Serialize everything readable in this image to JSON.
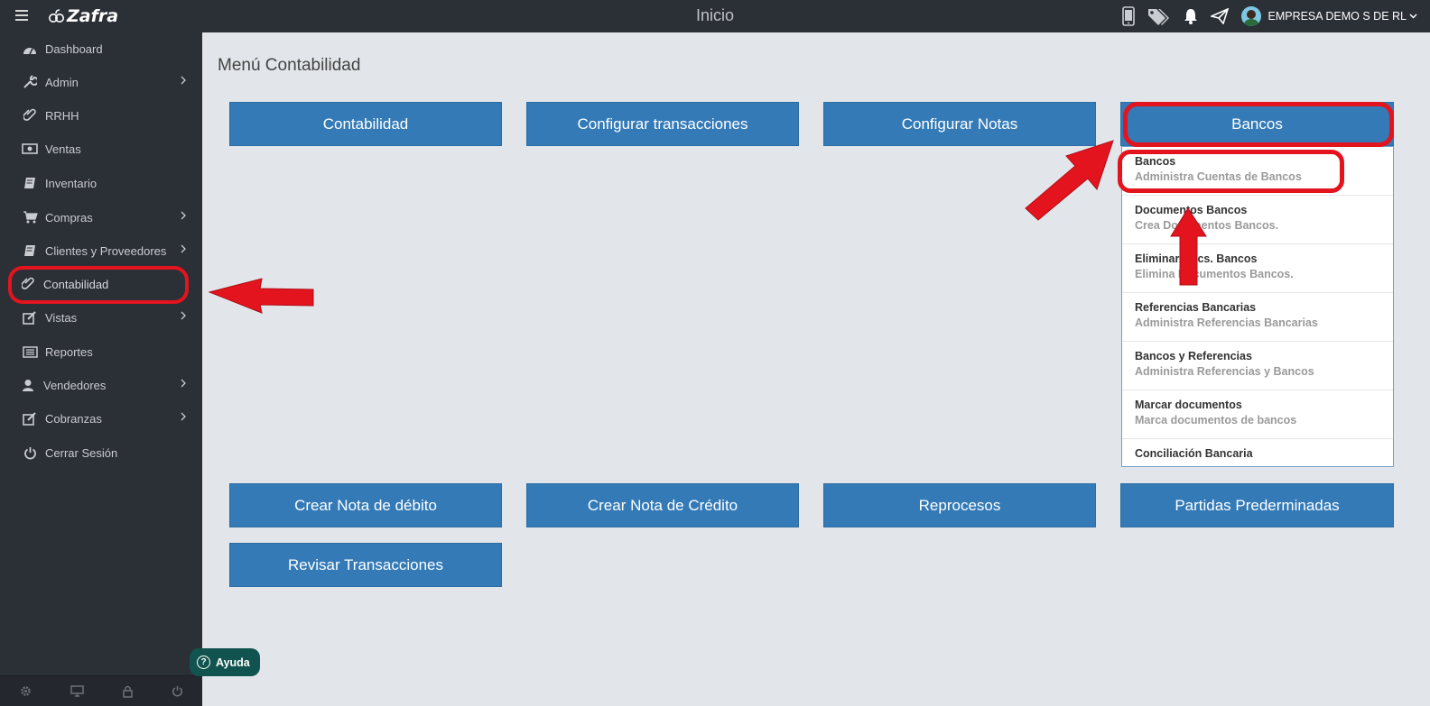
{
  "app": {
    "name": "Zafra",
    "page_title": "Inicio",
    "company": "EMPRESA DEMO S DE RL"
  },
  "topbar_icons": [
    "phone-icon",
    "tags-icon",
    "bell-icon",
    "paper-plane-icon"
  ],
  "sidebar": {
    "items": [
      {
        "label": "Dashboard",
        "icon": "dashboard-icon",
        "has_submenu": false
      },
      {
        "label": "Admin",
        "icon": "wrench-icon",
        "has_submenu": true
      },
      {
        "label": "RRHH",
        "icon": "paperclip-icon",
        "has_submenu": false
      },
      {
        "label": "Ventas",
        "icon": "money-icon",
        "has_submenu": false
      },
      {
        "label": "Inventario",
        "icon": "book-icon",
        "has_submenu": false
      },
      {
        "label": "Compras",
        "icon": "cart-icon",
        "has_submenu": true
      },
      {
        "label": "Clientes y Proveedores",
        "icon": "book-icon",
        "has_submenu": true
      },
      {
        "label": "Contabilidad",
        "icon": "paperclip-icon",
        "has_submenu": false,
        "active": true
      },
      {
        "label": "Vistas",
        "icon": "edit-icon",
        "has_submenu": true
      },
      {
        "label": "Reportes",
        "icon": "list-icon",
        "has_submenu": false
      },
      {
        "label": "Vendedores",
        "icon": "user-icon",
        "has_submenu": true
      },
      {
        "label": "Cobranzas",
        "icon": "edit-icon",
        "has_submenu": true
      },
      {
        "label": "Cerrar Sesión",
        "icon": "power-icon",
        "has_submenu": false
      }
    ],
    "footer_icons": [
      "gear-icon",
      "monitor-icon",
      "lock-icon",
      "power-icon"
    ]
  },
  "main": {
    "heading": "Menú Contabilidad",
    "tiles_row1": [
      "Contabilidad",
      "Configurar transacciones",
      "Configurar Notas",
      "Bancos"
    ],
    "tiles_row2": [
      "Crear Nota de débito",
      "Crear Nota de Crédito",
      "Reprocesos",
      "Partidas Prederminadas"
    ],
    "tiles_row3": [
      "Revisar Transacciones"
    ],
    "bancos_dropdown": [
      {
        "title": "Bancos",
        "desc": "Administra Cuentas de Bancos"
      },
      {
        "title": "Documentos Bancos",
        "desc": "Crea Documentos Bancos."
      },
      {
        "title": "Eliminar Docs. Bancos",
        "desc": "Elimina Documentos Bancos."
      },
      {
        "title": "Referencias Bancarias",
        "desc": "Administra Referencias Bancarias"
      },
      {
        "title": "Bancos y Referencias",
        "desc": "Administra Referencias y Bancos"
      },
      {
        "title": "Marcar documentos",
        "desc": "Marca documentos de bancos"
      },
      {
        "title": "Conciliación Bancaria",
        "desc": ""
      }
    ]
  },
  "help_button": "Ayuda",
  "colors": {
    "sidebar_bg": "#2b2f36",
    "tile_blue": "#337ab7",
    "annotation_red": "#e3141e",
    "help_green": "#11544f"
  }
}
